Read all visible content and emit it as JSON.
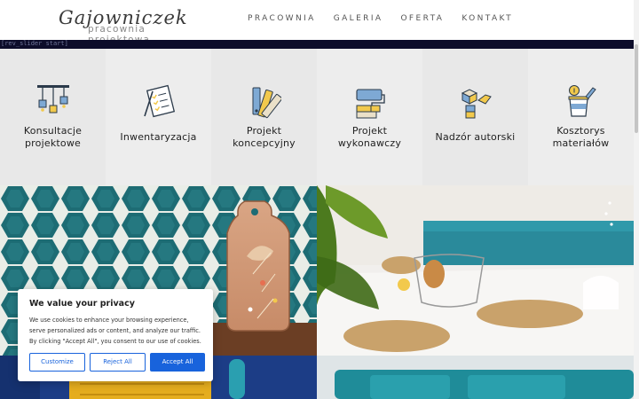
{
  "logo": {
    "main": "Gajowniczek",
    "sub": "pracownia projektowa"
  },
  "nav": [
    {
      "label": "PRACOWNIA"
    },
    {
      "label": "GALERIA"
    },
    {
      "label": "OFERTA"
    },
    {
      "label": "KONTAKT"
    }
  ],
  "slider_marker": "[rev_slider start]",
  "services": [
    {
      "label": "Konsultacje\nprojektowe",
      "icon": "lamps-icon"
    },
    {
      "label": "Inwentaryzacja",
      "icon": "checklist-icon"
    },
    {
      "label": "Projekt\nkoncepcyjny",
      "icon": "color-swatches-icon"
    },
    {
      "label": "Projekt\nwykonawczy",
      "icon": "paint-roller-icon"
    },
    {
      "label": "Nadzór autorski",
      "icon": "blocks-icon"
    },
    {
      "label": "Kosztorys\nmateriałów",
      "icon": "paint-bucket-icon"
    }
  ],
  "cookie": {
    "title": "We value your privacy",
    "text": "We use cookies to enhance your browsing experience, serve personalized ads or content, and analyze our traffic. By clicking \"Accept All\", you consent to our use of cookies.",
    "customize": "Customize",
    "reject": "Reject All",
    "accept": "Accept All"
  },
  "colors": {
    "accent": "#1863dc",
    "slider_bar": "#0d0d2a",
    "tile_teal": "#1f6f77"
  }
}
